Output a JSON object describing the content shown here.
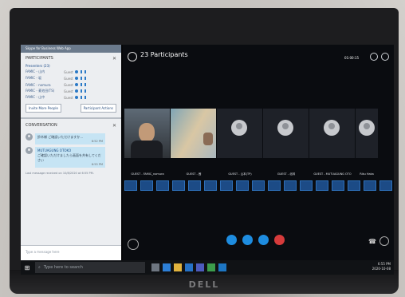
{
  "window": {
    "title": "Skype for Business Web App"
  },
  "participants_panel": {
    "heading": "PARTICIPANTS",
    "presenters_label": "Presenters (23)",
    "rows": [
      {
        "name": "FAMIC - 山内",
        "tag": "Guest"
      },
      {
        "name": "FAMIC - 坂",
        "tag": "Guest"
      },
      {
        "name": "FAMIC - nomura",
        "tag": "Guest"
      },
      {
        "name": "FAMIC - 菱池田(TS)",
        "tag": "Guest"
      },
      {
        "name": "FAMIC - 山中",
        "tag": "Guest"
      }
    ],
    "invite_button": "Invite More People",
    "actions_button": "Participant Actions"
  },
  "conversation_panel": {
    "heading": "CONVERSATION",
    "messages": [
      {
        "sender": "",
        "text": "鈴木様 ご確認いただけますか…",
        "time": "6:52 PM"
      },
      {
        "sender": "MUTUAGUNG OTOKO",
        "text": "ご確認いただけましたら画面を共有してください",
        "time": "6:55 PM"
      }
    ],
    "last_message": "Last message received on 10/8/2020 at 6:55 PM.",
    "compose_placeholder": "Type a message here"
  },
  "meeting": {
    "participant_count": "23 Participants",
    "signal_readout": "01:00:15",
    "tiles": [
      {
        "label": "GUEST - FAMIC_nomura",
        "kind": "video"
      },
      {
        "label": "GUEST - 茜",
        "kind": "video2"
      },
      {
        "label": "GUEST - 山本(TP)",
        "kind": "avatar"
      },
      {
        "label": "GUEST - 北林",
        "kind": "avatar"
      },
      {
        "label": "GUEST - MUTUAGUNG OTO",
        "kind": "avatar"
      },
      {
        "label": "Riku Haka",
        "kind": "avatar-small"
      }
    ],
    "chip_count": 18
  },
  "taskbar": {
    "search_placeholder": "Type here to search",
    "time": "6:55 PM",
    "date": "2020-10-08"
  },
  "brand": {
    "logo_text": "DELL"
  },
  "colors": {
    "accent": "#1e8de0",
    "hangup": "#d63b3b",
    "chip": "#1c4b86"
  }
}
